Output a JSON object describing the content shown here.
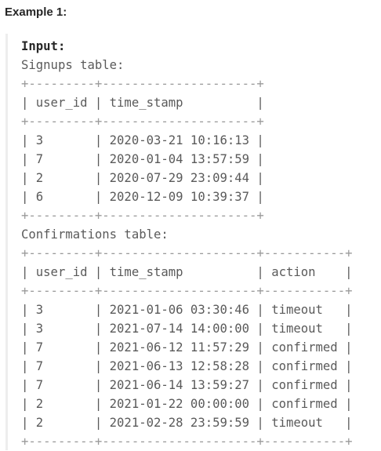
{
  "example": {
    "title": "Example 1:",
    "input_label": "Input:",
    "signups_label": "Signups table:",
    "signups_border": "+---------+---------------------+",
    "signups_header": "| user_id | time_stamp          |",
    "signups_rows": [
      "| 3       | 2020-03-21 10:16:13 |",
      "| 7       | 2020-01-04 13:57:59 |",
      "| 2       | 2020-07-29 23:09:44 |",
      "| 6       | 2020-12-09 10:39:37 |"
    ],
    "confirmations_label": "Confirmations table:",
    "confirmations_border": "+---------+---------------------+-----------+",
    "confirmations_header": "| user_id | time_stamp          | action    |",
    "confirmations_rows": [
      "| 3       | 2021-01-06 03:30:46 | timeout   |",
      "| 3       | 2021-07-14 14:00:00 | timeout   |",
      "| 7       | 2021-06-12 11:57:29 | confirmed |",
      "| 7       | 2021-06-13 12:58:28 | confirmed |",
      "| 7       | 2021-06-14 13:59:27 | confirmed |",
      "| 2       | 2021-01-22 00:00:00 | confirmed |",
      "| 2       | 2021-02-28 23:59:59 | timeout   |"
    ]
  }
}
